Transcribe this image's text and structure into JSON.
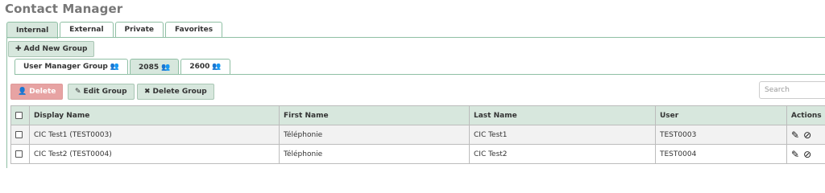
{
  "app_title": "Contact Manager",
  "main_tabs": [
    {
      "label": "Internal",
      "active": true
    },
    {
      "label": "External",
      "active": false
    },
    {
      "label": "Private",
      "active": false
    },
    {
      "label": "Favorites",
      "active": false
    }
  ],
  "add_group_label": "Add New Group",
  "group_tabs": [
    {
      "label": "User Manager Group",
      "active": false
    },
    {
      "label": "2085",
      "active": true
    },
    {
      "label": "2600",
      "active": false
    }
  ],
  "toolbar": {
    "delete_label": "Delete",
    "edit_group_label": "Edit Group",
    "delete_group_label": "Delete Group"
  },
  "search": {
    "placeholder": "Search"
  },
  "table": {
    "headers": [
      "Display Name",
      "First Name",
      "Last Name",
      "User",
      "Actions"
    ],
    "rows": [
      {
        "display_name": "CIC Test1 (TEST0003)",
        "first_name": "Téléphonie",
        "last_name": "CIC Test1",
        "user": "TEST0003"
      },
      {
        "display_name": "CIC Test2 (TEST0004)",
        "first_name": "Téléphonie",
        "last_name": "CIC Test2",
        "user": "TEST0004"
      }
    ]
  },
  "icons": {
    "plus": "plus-icon",
    "group": "users-icon",
    "user_delete": "user-minus-icon",
    "pencil": "pencil-icon",
    "times": "times-icon",
    "edit": "edit-icon",
    "block": "ban-icon"
  },
  "colors": {
    "accent": "#d7e7dd",
    "border": "#8fbfa4",
    "danger": "#e7a3a3"
  }
}
